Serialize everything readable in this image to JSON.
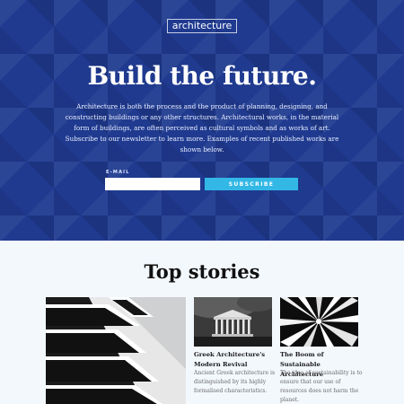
{
  "header": {
    "logo_text": "architecture"
  },
  "hero": {
    "title": "Build the future.",
    "description": "Architecture is both the process and the product of planning, designing, and constructing buildings or any other structures. Architectural works, in the material form of buildings, are often perceived as cultural symbols and as works of art. Subscribe to our newsletter to learn more. Examples of recent published works are shown below.",
    "email_label": "E-MAIL",
    "email_value": "",
    "subscribe_label": "SUBSCRIBE",
    "background_color": "#1f3a8f",
    "button_color": "#33b8e6"
  },
  "stories": {
    "heading": "Top stories",
    "items": [
      {
        "title": "Greek Architecture's Modern Revival",
        "description": "Ancient Greek architecture is distinguished by its highly formalised characteristics."
      },
      {
        "title": "The Boom of Sustainable Architecture",
        "description": "The idea of sustainability is to ensure that our use of resources does not harm the planet."
      }
    ]
  }
}
